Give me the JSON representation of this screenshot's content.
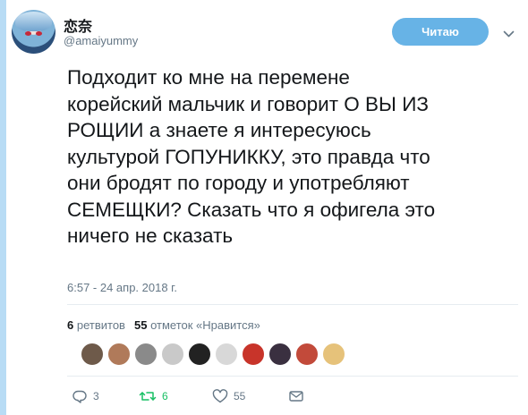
{
  "author": {
    "name": "恋奈",
    "handle": "@amaiyummy"
  },
  "follow_button": {
    "label": "Читаю"
  },
  "tweet": {
    "lines": [
      "Подходит ко мне на перемене",
      "корейский мальчик и говорит О ВЫ ИЗ",
      "РОЩИИ а знаете я интересуюсь",
      "культурой ГОПУНИККУ, это правда что",
      "они бродят по городу и употребляют",
      "СЕМЕЩКИ? Сказать что я офигела это",
      "ничего не сказать"
    ],
    "timestamp": "6:57 - 24 апр. 2018 г."
  },
  "stats": {
    "retweets_count": "6",
    "retweets_label": "ретвитов",
    "likes_count": "55",
    "likes_label": "отметок «Нравится»"
  },
  "likers": [
    {
      "color": "#6e5a4a"
    },
    {
      "color": "#b07a5a"
    },
    {
      "color": "#8a8a8a"
    },
    {
      "color": "#c9c9c9"
    },
    {
      "color": "#222222"
    },
    {
      "color": "#d8d8d8"
    },
    {
      "color": "#c8342a"
    },
    {
      "color": "#3a3040"
    },
    {
      "color": "#c24a3a"
    },
    {
      "color": "#e6c27a"
    }
  ],
  "actions": {
    "reply_count": "3",
    "retweet_count": "6",
    "like_count": "55"
  },
  "colors": {
    "accent": "#67b3e6",
    "retweet_green": "#17bf63",
    "muted": "#657786",
    "left_bar": "#b8dcf5"
  },
  "icons": {
    "reply": "reply-icon",
    "retweet": "retweet-icon",
    "like": "heart-icon",
    "dm": "envelope-icon",
    "more": "chevron-down-icon"
  }
}
